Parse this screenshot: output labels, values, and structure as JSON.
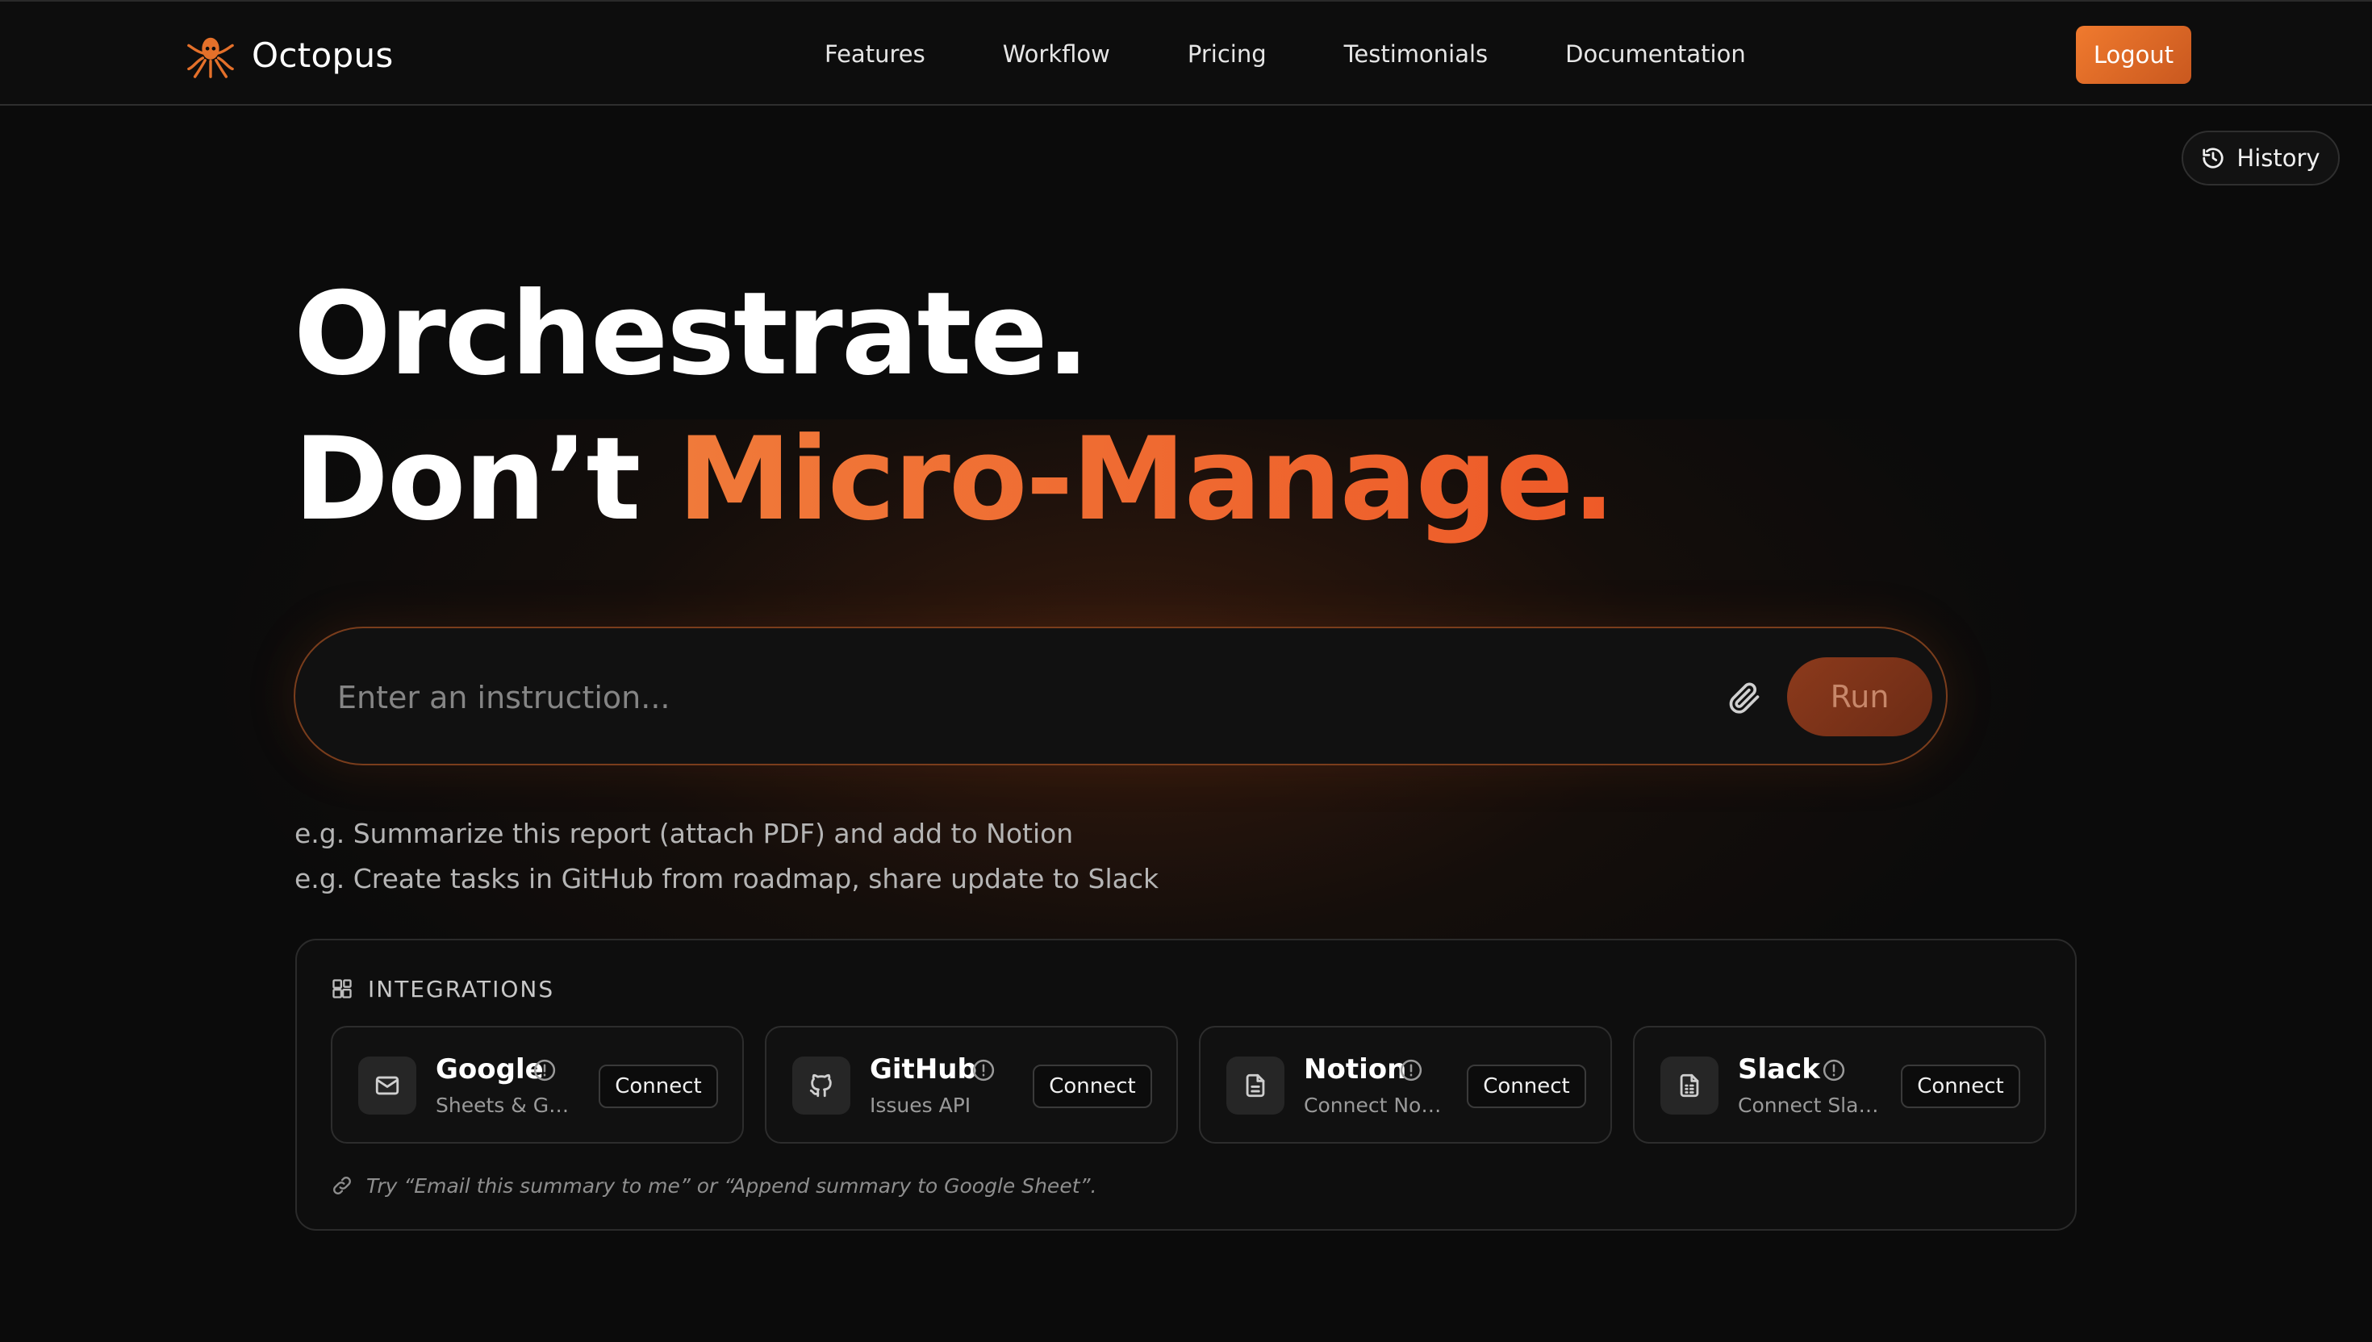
{
  "header": {
    "brand": "Octopus",
    "nav": [
      "Features",
      "Workflow",
      "Pricing",
      "Testimonials",
      "Documentation"
    ],
    "logout_label": "Logout"
  },
  "history": {
    "label": "History",
    "icon": "history-icon"
  },
  "hero": {
    "line1": "Orchestrate.",
    "line2_prefix": "Don’t ",
    "line2_accent": "Micro-Manage."
  },
  "instruction": {
    "placeholder": "Enter an instruction...",
    "attach_icon": "paperclip-icon",
    "run_label": "Run"
  },
  "examples": [
    "e.g. Summarize this report (attach PDF) and add to Notion",
    "e.g. Create tasks in GitHub from roadmap, share update to Slack"
  ],
  "integrations": {
    "title": "INTEGRATIONS",
    "cards": [
      {
        "name": "Google",
        "subtitle": "Sheets & Gm...",
        "icon": "mail-icon",
        "button": "Connect"
      },
      {
        "name": "GitHub",
        "subtitle": "Issues API",
        "icon": "github-icon",
        "button": "Connect"
      },
      {
        "name": "Notion",
        "subtitle": "Connect Noti...",
        "icon": "document-icon",
        "button": "Connect"
      },
      {
        "name": "Slack",
        "subtitle": "Connect Slack",
        "icon": "spreadsheet-icon",
        "button": "Connect"
      }
    ],
    "hint": "Try “Email this summary to me” or “Append summary to Google Sheet”."
  },
  "colors": {
    "background": "#0b0b0b",
    "accent": "#f07a3a",
    "accent_deep": "#ee5a28",
    "run_button": "#7a3219",
    "logout_button": "#e4702a"
  }
}
